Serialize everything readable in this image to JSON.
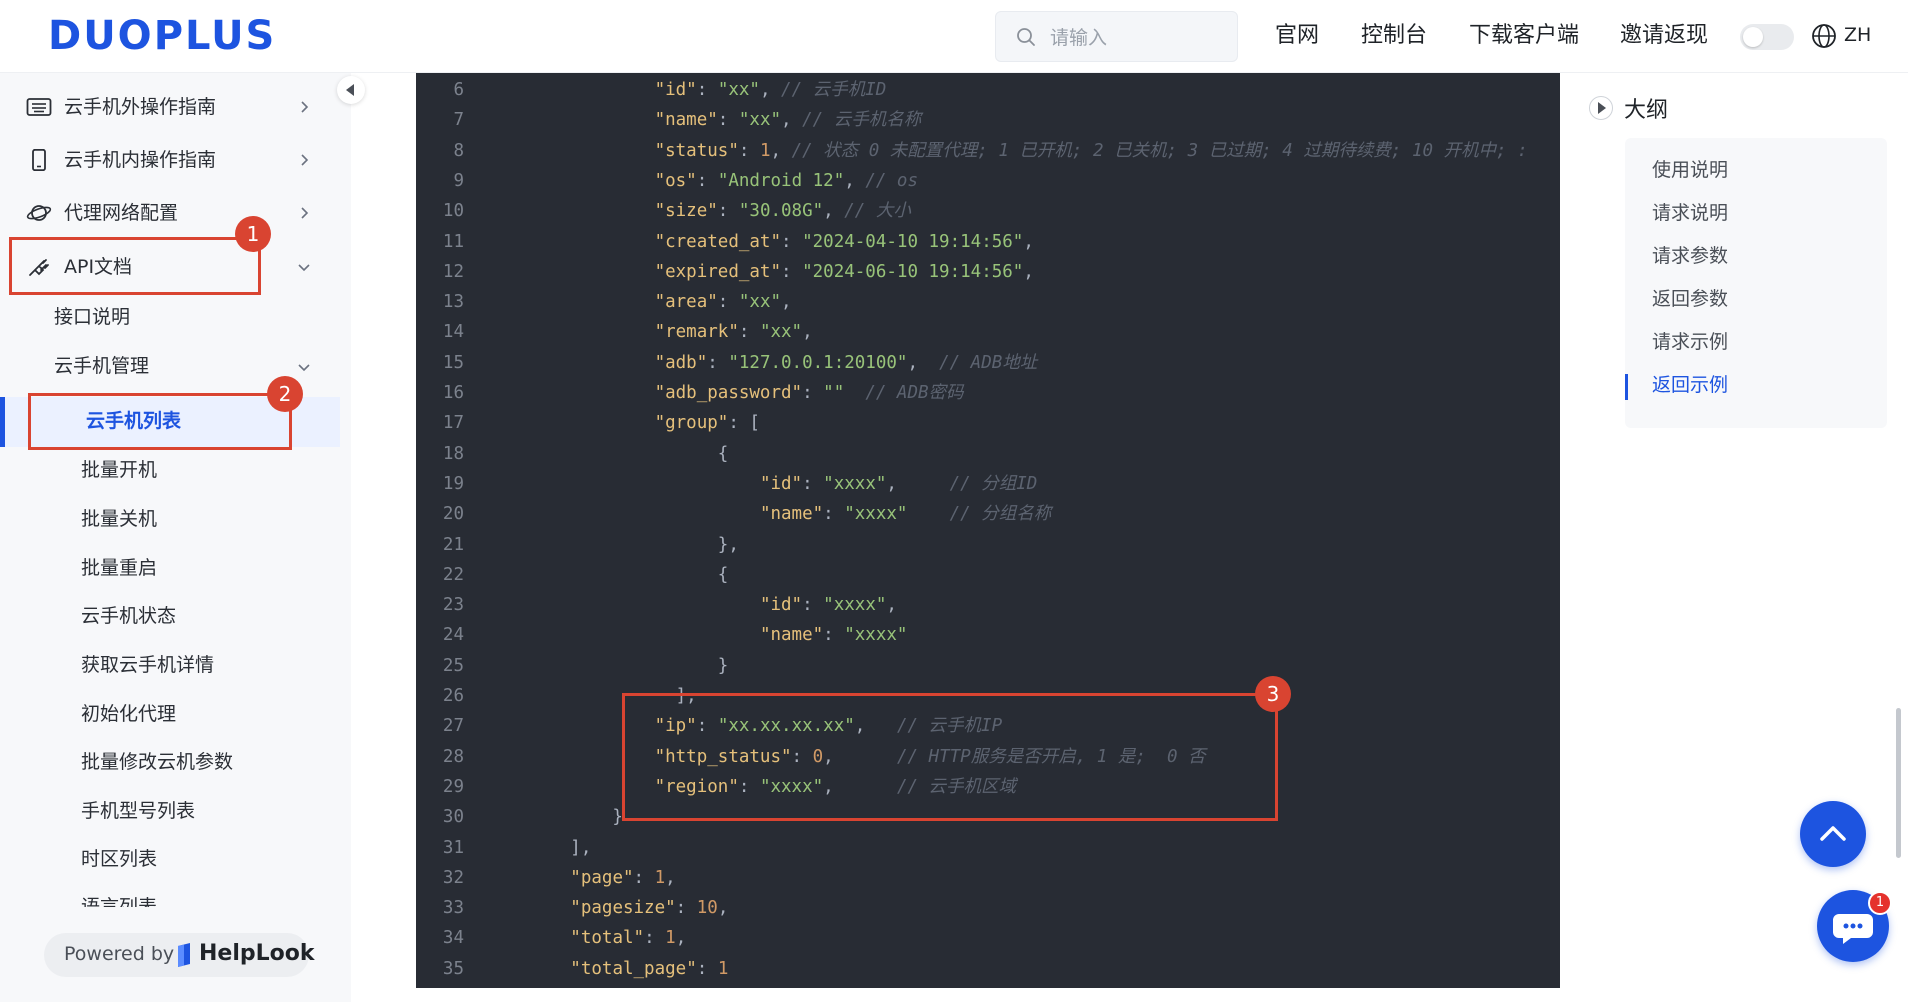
{
  "header": {
    "logo": "DUOPLUS",
    "search_placeholder": "请输入",
    "nav": [
      "官网",
      "控制台",
      "下载客户端",
      "邀请返现"
    ],
    "lang": "ZH"
  },
  "sidebar": {
    "items": [
      {
        "label": "云手机外操作指南",
        "icon": "keyboard-icon"
      },
      {
        "label": "云手机内操作指南",
        "icon": "phone-icon"
      },
      {
        "label": "代理网络配置",
        "icon": "planet-icon"
      },
      {
        "label": "API文档",
        "icon": "plug-icon"
      }
    ],
    "sub": {
      "intro": "接口说明",
      "group": "云手机管理",
      "children": [
        "云手机列表",
        "批量开机",
        "批量关机",
        "批量重启",
        "云手机状态",
        "获取云手机详情",
        "初始化代理",
        "批量修改云机参数",
        "手机型号列表",
        "时区列表",
        "语言列表"
      ]
    },
    "powered_by": "Powered by",
    "powered_brand": "HelpLook"
  },
  "annotations": {
    "badge1": "1",
    "badge2": "2",
    "badge3": "3"
  },
  "code": {
    "lines": [
      {
        "n": "6",
        "t": "                \"id\": \"xx\", // 云手机ID"
      },
      {
        "n": "7",
        "t": "                \"name\": \"xx\", // 云手机名称"
      },
      {
        "n": "8",
        "t": "                \"status\": 1, // 状态 0 未配置代理; 1 已开机; 2 已关机; 3 已过期; 4 过期待续费; 10 开机中; :"
      },
      {
        "n": "9",
        "t": "                \"os\": \"Android 12\", // os"
      },
      {
        "n": "10",
        "t": "                \"size\": \"30.08G\", // 大小"
      },
      {
        "n": "11",
        "t": "                \"created_at\": \"2024-04-10 19:14:56\","
      },
      {
        "n": "12",
        "t": "                \"expired_at\": \"2024-06-10 19:14:56\","
      },
      {
        "n": "13",
        "t": "                \"area\": \"xx\","
      },
      {
        "n": "14",
        "t": "                \"remark\": \"xx\","
      },
      {
        "n": "15",
        "t": "                \"adb\": \"127.0.0.1:20100\",  // ADB地址"
      },
      {
        "n": "16",
        "t": "                \"adb_password\": \"\"  // ADB密码"
      },
      {
        "n": "17",
        "t": "                \"group\": ["
      },
      {
        "n": "18",
        "t": "                      {"
      },
      {
        "n": "19",
        "t": "                          \"id\": \"xxxx\",     // 分组ID"
      },
      {
        "n": "20",
        "t": "                          \"name\": \"xxxx\"    // 分组名称"
      },
      {
        "n": "21",
        "t": "                      },"
      },
      {
        "n": "22",
        "t": "                      {"
      },
      {
        "n": "23",
        "t": "                          \"id\": \"xxxx\","
      },
      {
        "n": "24",
        "t": "                          \"name\": \"xxxx\""
      },
      {
        "n": "25",
        "t": "                      }"
      },
      {
        "n": "26",
        "t": "                  ],"
      },
      {
        "n": "27",
        "t": "                \"ip\": \"xx.xx.xx.xx\",   // 云手机IP"
      },
      {
        "n": "28",
        "t": "                \"http_status\": 0,      // HTTP服务是否开启, 1 是;  0 否"
      },
      {
        "n": "29",
        "t": "                \"region\": \"xxxx\",      // 云手机区域"
      },
      {
        "n": "30",
        "t": "            }"
      },
      {
        "n": "31",
        "t": "        ],"
      },
      {
        "n": "32",
        "t": "        \"page\": 1,"
      },
      {
        "n": "33",
        "t": "        \"pagesize\": 10,"
      },
      {
        "n": "34",
        "t": "        \"total\": 1,"
      },
      {
        "n": "35",
        "t": "        \"total_page\": 1"
      }
    ]
  },
  "outline": {
    "title": "大纲",
    "items": [
      "使用说明",
      "请求说明",
      "请求参数",
      "返回参数",
      "请求示例",
      "返回示例"
    ]
  },
  "chat_badge": "1",
  "colors": {
    "accent": "#1d54e0",
    "annotation": "#d94431",
    "code_bg": "#282c34"
  }
}
